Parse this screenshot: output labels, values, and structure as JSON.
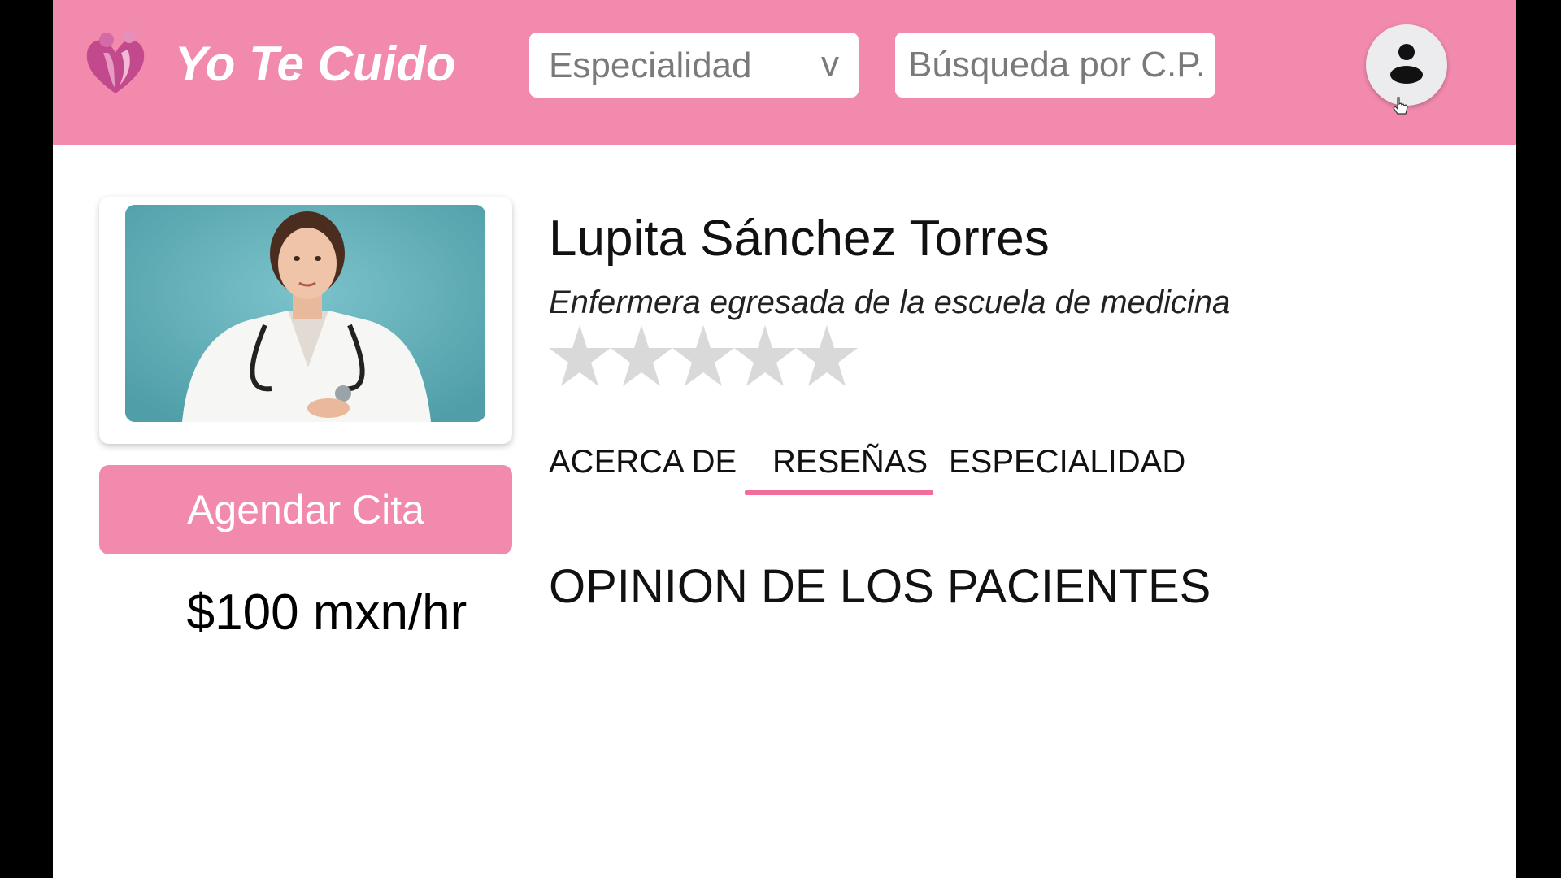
{
  "colors": {
    "brand_pink": "#f28aae",
    "tab_underline": "#f06d9c",
    "star_gray": "#d9d9d9",
    "photo_background": "#6cb6bf"
  },
  "header": {
    "brand_name": "Yo Te Cuido",
    "logo_icon": "family-heart-icon",
    "specialty_select": {
      "value": "Especialidad",
      "caret": "v"
    },
    "zip_search": {
      "placeholder": "Búsqueda por C.P."
    },
    "account_icon": "user-avatar-icon"
  },
  "profile": {
    "photo_icon": "nurse-portrait",
    "book_button_label": "Agendar Cita",
    "price": "$100 mxn/hr",
    "name": "Lupita Sánchez Torres",
    "subtitle": "Enfermera egresada de la escuela de medicina",
    "rating": {
      "value": 0,
      "max": 5
    }
  },
  "tabs": [
    {
      "label": "ACERCA DE",
      "active": false
    },
    {
      "label": "RESEÑAS",
      "active": true
    },
    {
      "label": "ESPECIALIDAD",
      "active": false
    }
  ],
  "reviews_section": {
    "heading": "OPINION DE LOS PACIENTES"
  }
}
